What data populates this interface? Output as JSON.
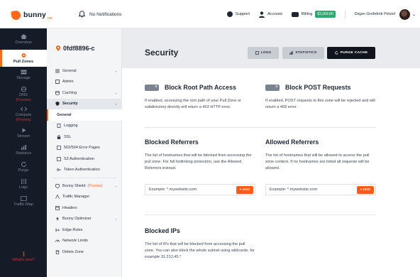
{
  "topbar": {
    "logo_text": "bunny",
    "logo_suffix": "net",
    "notifications_label": "No Notifications",
    "support_label": "Support",
    "account_label": "Account",
    "billing_label": "Billing",
    "balance": "$2,069.80",
    "username": "Dejan Grofelnik Pelzel"
  },
  "icon_nav": [
    {
      "label": "Overview",
      "icon": "home-icon"
    },
    {
      "label": "Pull Zones",
      "icon": "location-pin-icon",
      "active": true
    },
    {
      "label": "Storage",
      "icon": "storage-icon"
    },
    {
      "label": "DNS",
      "icon": "globe-icon",
      "sub": "(Preview)"
    },
    {
      "label": "Compute",
      "icon": "code-icon",
      "sub": "(Preview)"
    },
    {
      "label": "Stream",
      "icon": "play-icon"
    },
    {
      "label": "Statistics",
      "icon": "chart-icon"
    },
    {
      "label": "Purge",
      "icon": "refresh-icon"
    },
    {
      "label": "Logs",
      "icon": "logs-icon"
    },
    {
      "label": "Traffic Map",
      "icon": "map-icon"
    },
    {
      "label": "What's new?",
      "icon": "gift-icon"
    }
  ],
  "zone": {
    "name": "0fdf8896-c"
  },
  "menu": {
    "general": "General",
    "admin": "Admin",
    "caching": "Caching",
    "security": "Security",
    "security_items": [
      "General",
      "Logging",
      "SSL",
      "502/504 Error Pages",
      "S3 Authentication",
      "Token Authentication"
    ],
    "bunny_shield": "Bunny Shield",
    "bunny_shield_tag": "(Preview)",
    "traffic_manager": "Traffic Manager",
    "headers": "Headers",
    "bunny_optimizer": "Bunny Optimizer",
    "edge_rules": "Edge Rules",
    "network_limits": "Network Limits",
    "delete_zone": "Delete Zone"
  },
  "page": {
    "title": "Security",
    "btn_logs": "Logs",
    "btn_statistics": "Statistics",
    "btn_purge": "Purge Cache"
  },
  "security": {
    "root_path": {
      "title": "Block Root Path Access",
      "desc": "If enabled, accessing the root path of your Pull Zone or subdirectory directly will return a 403 HTTP error."
    },
    "post": {
      "title": "Block POST Requests",
      "desc": "If enabled, POST requests to this zone will be rejected and will return a 403 error."
    },
    "blocked_referrers": {
      "title": "Blocked Referrers",
      "desc": "The list of hostnames that will be blocked from accessing the pull zone. For full hotlinking protection, use the Allowed Referrers instead.",
      "placeholder": "Example: *.mywebsite.com",
      "add": "+ ADD"
    },
    "allowed_referrers": {
      "title": "Allowed Referrers",
      "desc": "The list of hostnames that will be allowed to access the pull zone content. If no hostnames are listed all requests will be allowed.",
      "placeholder": "Example: *.mywebsite.com",
      "add": "+ ADD"
    },
    "blocked_ips": {
      "title": "Blocked IPs",
      "desc": "The list of IPs that will be blocked from accessing the pull zone. You can also block the whole subnet using wildcards, for example 31.212.45.*"
    }
  },
  "colors": {
    "accent": "#ff6a1a",
    "sidebar_dark": "#161c27",
    "balance_green": "#2ea66f"
  }
}
